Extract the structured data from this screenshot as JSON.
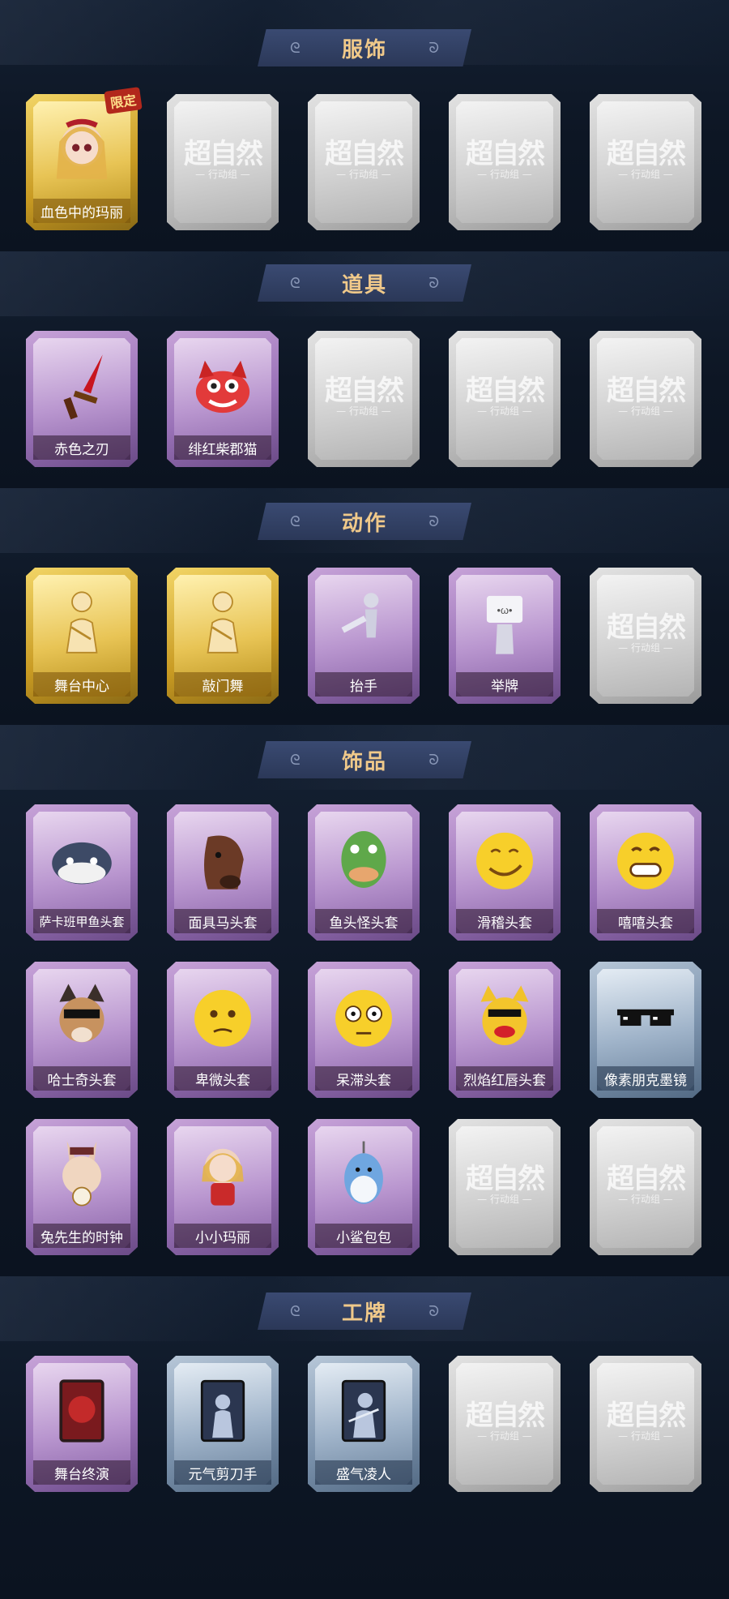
{
  "sections": [
    {
      "title": "服饰",
      "cards": [
        {
          "label": "血色中的玛丽",
          "rarity": "gold",
          "icon": "doll-girl-icon",
          "badge": "限定"
        },
        {
          "label": "",
          "rarity": "empty"
        },
        {
          "label": "",
          "rarity": "empty"
        },
        {
          "label": "",
          "rarity": "empty"
        },
        {
          "label": "",
          "rarity": "empty"
        }
      ]
    },
    {
      "title": "道具",
      "cards": [
        {
          "label": "赤色之刃",
          "rarity": "purple",
          "icon": "red-blade-icon"
        },
        {
          "label": "绯红柴郡猫",
          "rarity": "purple",
          "icon": "cheshire-cat-icon"
        },
        {
          "label": "",
          "rarity": "empty"
        },
        {
          "label": "",
          "rarity": "empty"
        },
        {
          "label": "",
          "rarity": "empty"
        }
      ]
    },
    {
      "title": "动作",
      "cards": [
        {
          "label": "舞台中心",
          "rarity": "gold",
          "icon": "pose-silhouette-icon"
        },
        {
          "label": "敲门舞",
          "rarity": "gold",
          "icon": "pose-silhouette-icon"
        },
        {
          "label": "抬手",
          "rarity": "purple",
          "icon": "raise-hand-icon"
        },
        {
          "label": "举牌",
          "rarity": "purple",
          "icon": "hold-sign-icon"
        },
        {
          "label": "",
          "rarity": "empty"
        }
      ]
    },
    {
      "title": "饰品",
      "cards": [
        {
          "label": "萨卡班甲鱼头套",
          "rarity": "purple",
          "icon": "fish-head-icon"
        },
        {
          "label": "面具马头套",
          "rarity": "purple",
          "icon": "horse-mask-icon"
        },
        {
          "label": "鱼头怪头套",
          "rarity": "purple",
          "icon": "fish-monster-icon"
        },
        {
          "label": "滑稽头套",
          "rarity": "purple",
          "icon": "smirk-face-icon"
        },
        {
          "label": "嘻嘻头套",
          "rarity": "purple",
          "icon": "grin-face-icon"
        },
        {
          "label": "哈士奇头套",
          "rarity": "purple",
          "icon": "husky-icon"
        },
        {
          "label": "卑微头套",
          "rarity": "purple",
          "icon": "pleading-face-icon"
        },
        {
          "label": "呆滞头套",
          "rarity": "purple",
          "icon": "dazed-face-icon"
        },
        {
          "label": "烈焰红唇头套",
          "rarity": "purple",
          "icon": "red-lips-mask-icon"
        },
        {
          "label": "像素朋克墨镜",
          "rarity": "blue",
          "icon": "pixel-sunglasses-icon"
        },
        {
          "label": "兔先生的时钟",
          "rarity": "purple",
          "icon": "rabbit-clock-icon"
        },
        {
          "label": "小小玛丽",
          "rarity": "purple",
          "icon": "little-mary-icon"
        },
        {
          "label": "小鲨包包",
          "rarity": "purple",
          "icon": "shark-bag-icon"
        },
        {
          "label": "",
          "rarity": "empty"
        },
        {
          "label": "",
          "rarity": "empty"
        }
      ]
    },
    {
      "title": "工牌",
      "cards": [
        {
          "label": "舞台终演",
          "rarity": "purple",
          "icon": "stage-card-icon"
        },
        {
          "label": "元气剪刀手",
          "rarity": "blue",
          "icon": "peace-sign-card-icon"
        },
        {
          "label": "盛气凌人",
          "rarity": "blue",
          "icon": "arrogant-card-icon"
        },
        {
          "label": "",
          "rarity": "empty"
        },
        {
          "label": "",
          "rarity": "empty"
        }
      ]
    }
  ],
  "placeholder": {
    "title": "超自然",
    "subtitle": "行动组"
  }
}
